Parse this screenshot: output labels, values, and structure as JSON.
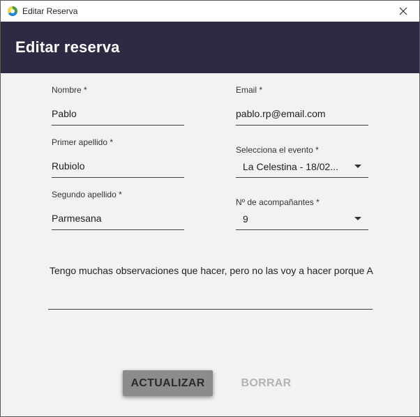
{
  "window": {
    "title": "Editar Reserva"
  },
  "header": {
    "title": "Editar reserva"
  },
  "form": {
    "nombre": {
      "label": "Nombre *",
      "value": "Pablo"
    },
    "primer_apellido": {
      "label": "Primer apellido *",
      "value": "Rubiolo"
    },
    "segundo_apellido": {
      "label": "Segundo apellido *",
      "value": "Parmesana"
    },
    "email": {
      "label": "Email *",
      "value": "pablo.rp@email.com"
    },
    "evento": {
      "label": "Selecciona el evento *",
      "value": "La Celestina - 18/02..."
    },
    "acompanantes": {
      "label": "Nº de acompañantes *",
      "value": "9"
    },
    "observaciones": {
      "value": "Tengo muchas observaciones que hacer, pero no las voy a hacer porque A"
    }
  },
  "buttons": {
    "update": "ACTUALIZAR",
    "clear": "BORRAR"
  },
  "colors": {
    "header_bg": "#2d2b44",
    "header_text": "#ffffff",
    "update_bg": "#8c8c8c",
    "clear_text": "#b3b3b3"
  },
  "icons": {
    "app": "app-logo-icon",
    "close": "close-icon",
    "dropdown": "caret-down-icon"
  }
}
